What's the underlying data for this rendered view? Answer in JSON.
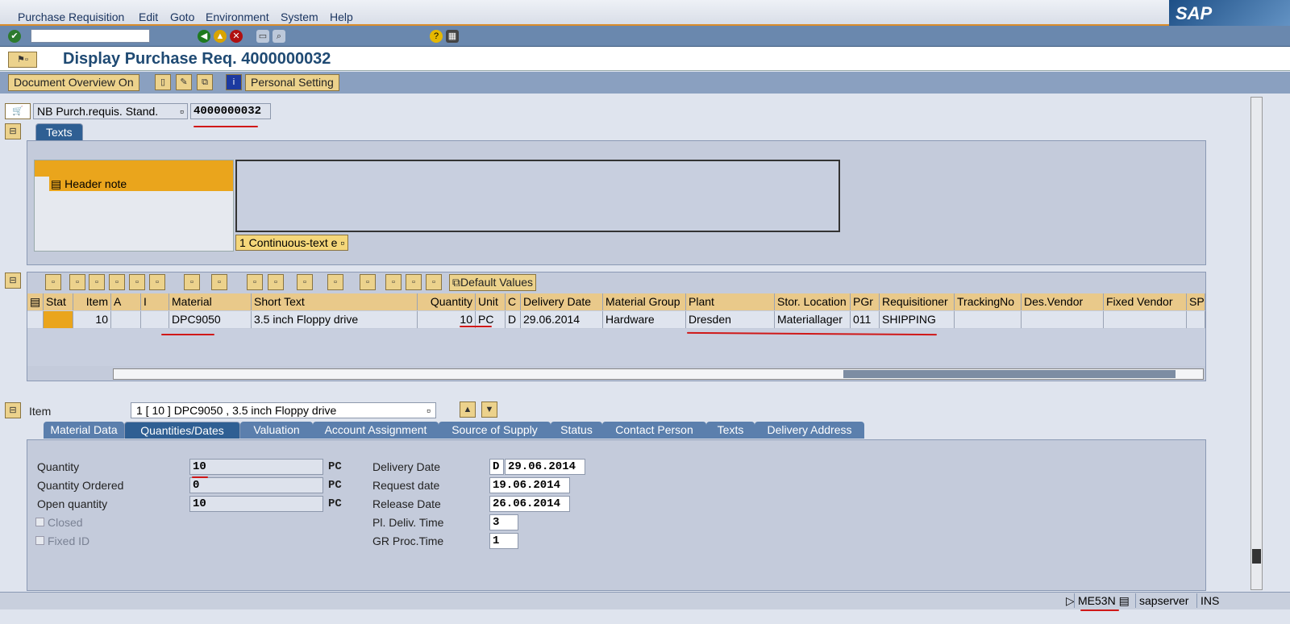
{
  "menu": [
    "Purchase Requisition",
    "Edit",
    "Goto",
    "Environment",
    "System",
    "Help"
  ],
  "logo": "SAP",
  "title": "Display Purchase Req. 4000000032",
  "appbar": {
    "doc_overview": "Document Overview On",
    "personal_setting": "Personal Setting"
  },
  "header": {
    "doc_type": "NB Purch.requis. Stand.",
    "doc_number": "4000000032",
    "tab": "Texts",
    "text_item": "Header note",
    "text_format": "1 Continuous-text e"
  },
  "grid": {
    "default_values": "Default Values",
    "columns": [
      "Stat",
      "Item",
      "A",
      "I",
      "Material",
      "Short Text",
      "Quantity",
      "Unit",
      "C",
      "Delivery Date",
      "Material Group",
      "Plant",
      "Stor. Location",
      "PGr",
      "Requisitioner",
      "TrackingNo",
      "Des.Vendor",
      "Fixed Vendor",
      "SP"
    ],
    "rows": [
      [
        "",
        "10",
        "",
        "",
        "DPC9050",
        "3.5 inch Floppy drive",
        "10",
        "PC",
        "D",
        "29.06.2014",
        "Hardware",
        "Dresden",
        "Materiallager",
        "011",
        "SHIPPING",
        "",
        "",
        "",
        ""
      ]
    ]
  },
  "item": {
    "label": "Item",
    "selected": "1 [ 10 ] DPC9050 , 3.5 inch Floppy drive",
    "tabs": [
      "Material Data",
      "Quantities/Dates",
      "Valuation",
      "Account Assignment",
      "Source of Supply",
      "Status",
      "Contact Person",
      "Texts",
      "Delivery Address"
    ],
    "active_tab": 1,
    "left": [
      {
        "label": "Quantity",
        "value": "10",
        "unit": "PC"
      },
      {
        "label": "Quantity Ordered",
        "value": "0",
        "unit": "PC"
      },
      {
        "label": "Open quantity",
        "value": "10",
        "unit": "PC"
      }
    ],
    "checks": [
      {
        "label": "Closed",
        "checked": false
      },
      {
        "label": "Fixed ID",
        "checked": false
      }
    ],
    "right": [
      {
        "label": "Delivery Date",
        "prefix": "D",
        "value": "29.06.2014"
      },
      {
        "label": "Request date",
        "value": "19.06.2014"
      },
      {
        "label": "Release Date",
        "value": "26.06.2014"
      },
      {
        "label": "Pl. Deliv. Time",
        "value": "3"
      },
      {
        "label": "GR Proc.Time",
        "value": "1"
      }
    ]
  },
  "status": {
    "transaction": "ME53N",
    "server": "sapserver",
    "mode": "INS"
  }
}
